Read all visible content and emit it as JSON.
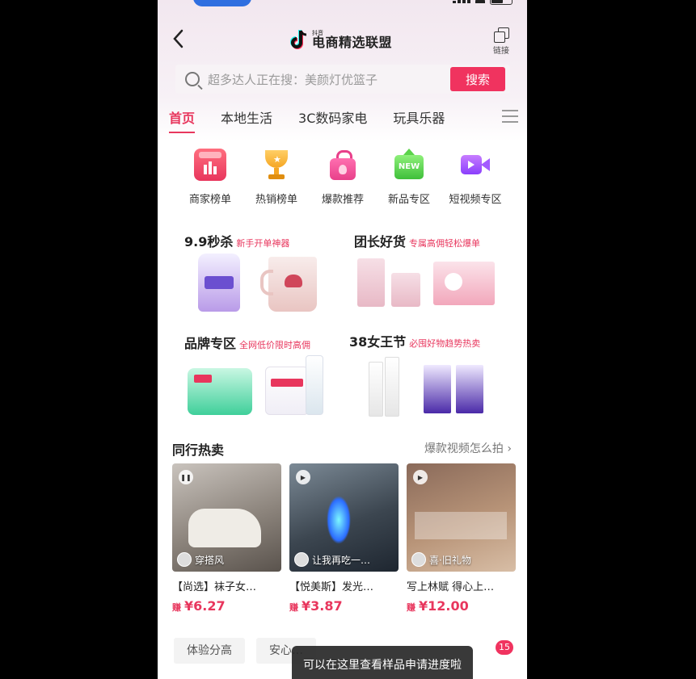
{
  "header": {
    "logo_small": "抖音",
    "logo_text": "电商精选联盟",
    "link_label": "链接"
  },
  "search": {
    "placeholder": "超多达人正在搜：美颜灯优篮子",
    "button": "搜索"
  },
  "tabs": [
    "首页",
    "本地生活",
    "3C数码家电",
    "玩具乐器"
  ],
  "categories": [
    {
      "label": "商家榜单",
      "icon": "store-ranking-icon"
    },
    {
      "label": "热销榜单",
      "icon": "trophy-icon"
    },
    {
      "label": "爆款推荐",
      "icon": "shopping-bag-icon"
    },
    {
      "label": "新品专区",
      "icon": "new-badge-icon"
    },
    {
      "label": "短视频专区",
      "icon": "video-camera-icon"
    }
  ],
  "promos": [
    {
      "title": "9.9秒杀",
      "tag": "新手开单神器"
    },
    {
      "title": "团长好货",
      "tag": "专属高佣轻松爆单"
    },
    {
      "title": "品牌专区",
      "tag": "全网低价限时高佣"
    },
    {
      "title": "38女王节",
      "tag": "必囤好物趋势热卖"
    }
  ],
  "hot": {
    "title": "同行热卖",
    "more": "爆款视频怎么拍 ›",
    "items": [
      {
        "caption": "穿搭风",
        "name": "【尚选】袜子女…",
        "earn": "赚",
        "price": "¥6.27"
      },
      {
        "caption": "让我再吃一…",
        "name": "【悦美斯】发光…",
        "earn": "赚",
        "price": "¥3.87"
      },
      {
        "caption": "喜·旧礼物",
        "name": "写上林赋 得心上…",
        "earn": "赚",
        "price": "¥12.00"
      }
    ]
  },
  "bottom": {
    "chips": [
      "体验分高",
      "安心…"
    ],
    "toast": "可以在这里查看样品申请进度啦",
    "badge": "15"
  },
  "colors": {
    "accent": "#e8365d",
    "search_button": "#f0335f"
  }
}
